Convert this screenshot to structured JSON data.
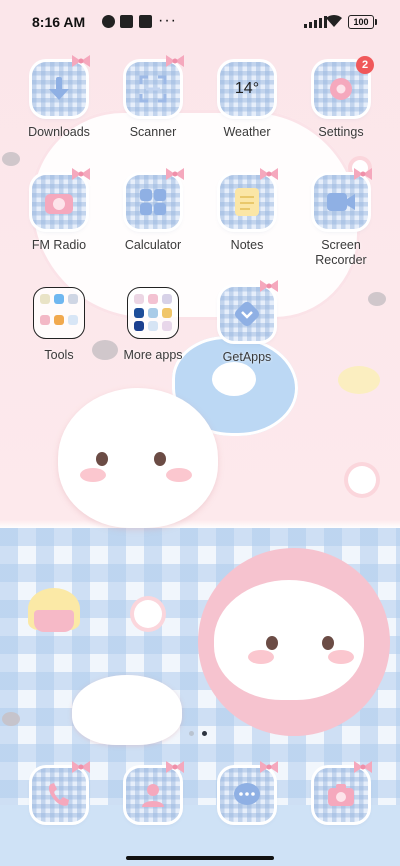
{
  "status_bar": {
    "time": "8:16 AM",
    "more": "···",
    "battery": "100"
  },
  "apps": {
    "downloads": "Downloads",
    "scanner": "Scanner",
    "weather": "Weather",
    "weather_temp": "14°",
    "settings": "Settings",
    "settings_badge": "2",
    "fm_radio": "FM Radio",
    "calculator": "Calculator",
    "notes": "Notes",
    "screen_recorder_1": "Screen",
    "screen_recorder_2": "Recorder",
    "tools": "Tools",
    "more_apps": "More apps",
    "getapps": "GetApps"
  },
  "pager": {
    "total": 2,
    "current": 2
  },
  "colors": {
    "accent_pink": "#f5a8bd",
    "tile_blue": "#9db9e6",
    "badge_red": "#f0585a"
  },
  "icons": {
    "dock": [
      "phone-icon",
      "contacts-icon",
      "messages-icon",
      "camera-icon"
    ]
  }
}
